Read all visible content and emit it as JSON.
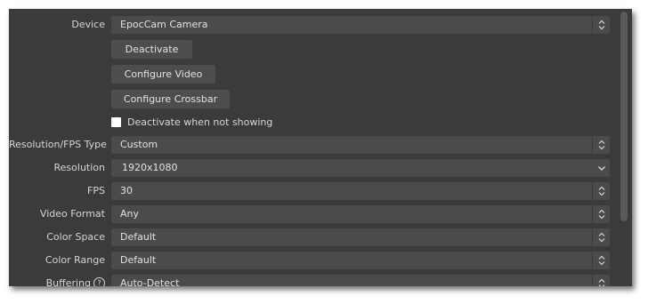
{
  "device": {
    "label": "Device",
    "value": "EpocCam Camera"
  },
  "buttons": {
    "deactivate": "Deactivate",
    "configure_video": "Configure Video",
    "configure_crossbar": "Configure Crossbar"
  },
  "checkbox": {
    "label": "Deactivate when not showing",
    "checked": false
  },
  "fields": {
    "resolution_fps_type": {
      "label": "Resolution/FPS Type",
      "value": "Custom"
    },
    "resolution": {
      "label": "Resolution",
      "value": "1920x1080"
    },
    "fps": {
      "label": "FPS",
      "value": "30"
    },
    "video_format": {
      "label": "Video Format",
      "value": "Any"
    },
    "color_space": {
      "label": "Color Space",
      "value": "Default"
    },
    "color_range": {
      "label": "Color Range",
      "value": "Default"
    },
    "buffering": {
      "label": "Buffering",
      "help": "?",
      "value": "Auto-Detect"
    }
  },
  "icons": {
    "combo": "updown-arrows-icon",
    "editable_combo": "chevron-down-icon",
    "help": "help-circle-icon"
  },
  "colors": {
    "panel_bg": "#3b3b3b",
    "control_bg": "#4b4b4b",
    "text": "#d8d8d8"
  }
}
